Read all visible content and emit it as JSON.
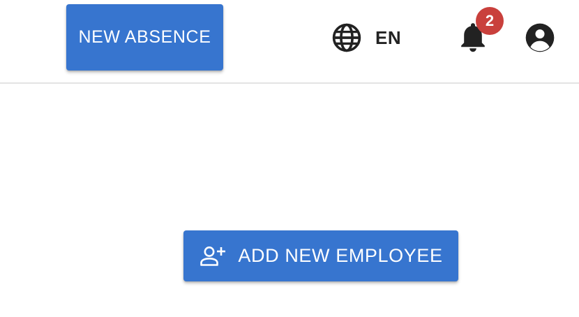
{
  "header": {
    "new_absence_label": "NEW ABSENCE",
    "language": {
      "icon": "globe-icon",
      "label": "EN"
    },
    "notifications": {
      "icon": "bell-icon",
      "count": "2"
    },
    "account": {
      "icon": "account-circle-icon"
    }
  },
  "main": {
    "add_employee_label": "ADD NEW EMPLOYEE",
    "add_employee_icon": "person-add-icon"
  },
  "colors": {
    "primary": "#3775cf",
    "badge": "#c9403c",
    "icon": "#222222",
    "divider": "#e3e3e3"
  }
}
